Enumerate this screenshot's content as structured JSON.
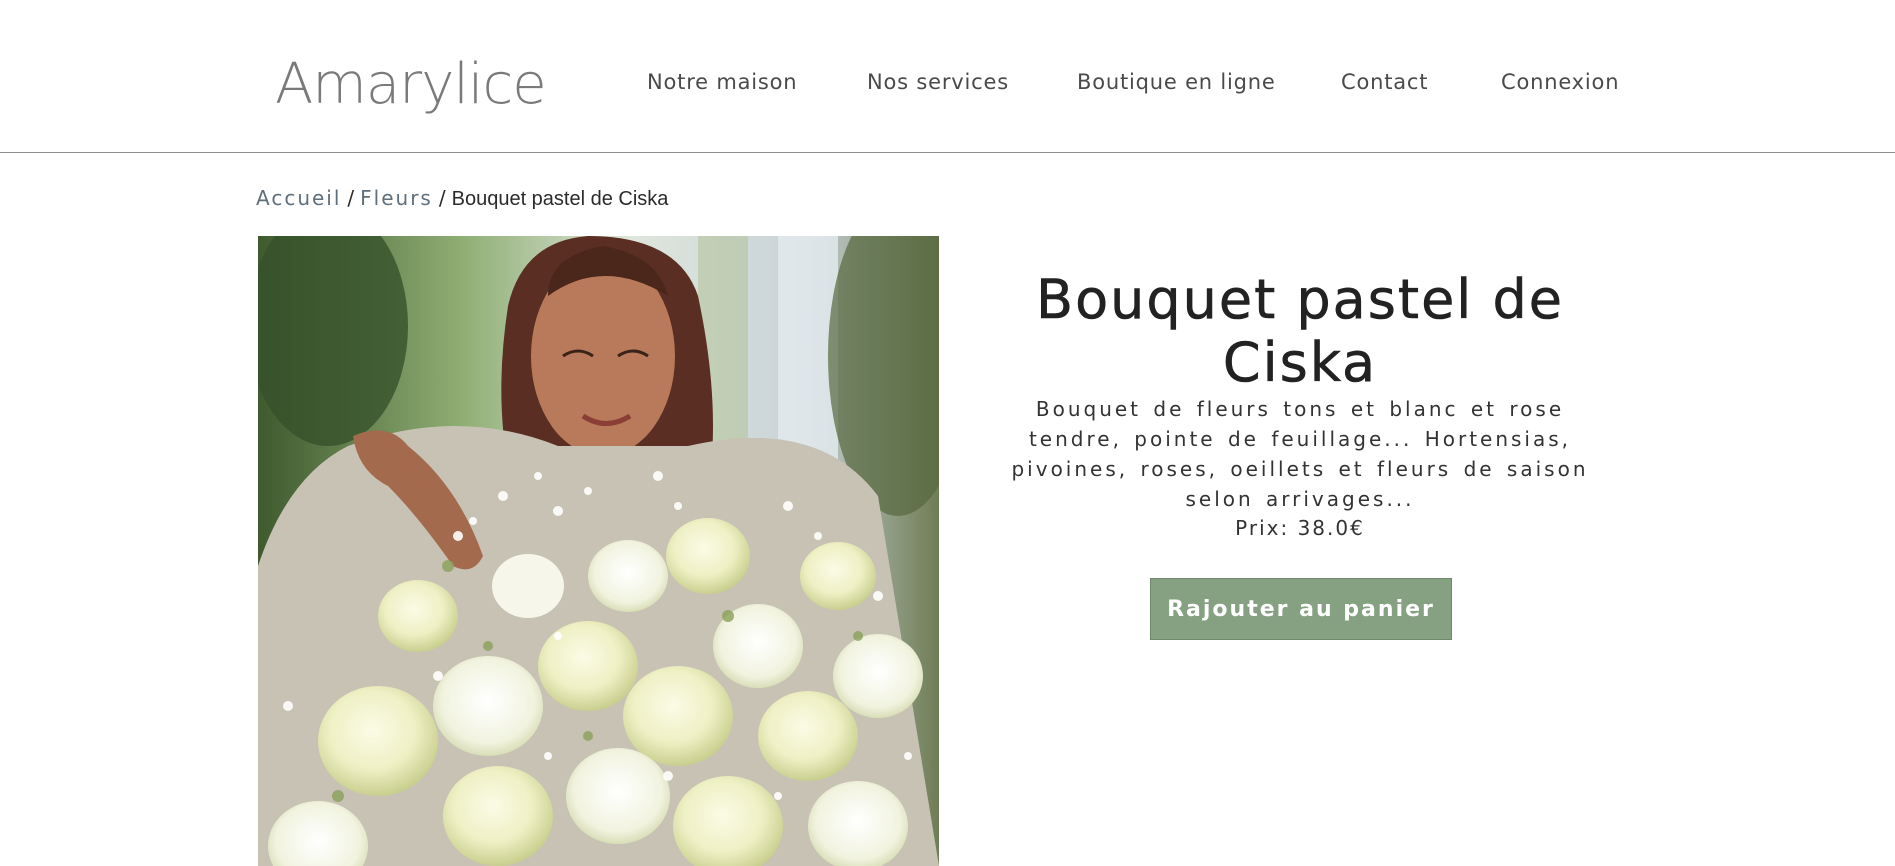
{
  "header": {
    "logo_text": "Amarylice",
    "nav": [
      {
        "label": "Notre maison"
      },
      {
        "label": "Nos services"
      },
      {
        "label": "Boutique en ligne"
      },
      {
        "label": "Contact"
      },
      {
        "label": "Connexion"
      }
    ]
  },
  "breadcrumb": {
    "home": "Accueil",
    "category": "Fleurs",
    "separator": "/",
    "current": "Bouquet pastel de Ciska"
  },
  "product": {
    "title": "Bouquet pastel de Ciska",
    "description": "Bouquet de fleurs tons et blanc et rose tendre, pointe de feuillage... Hortensias, pivoines, roses, oeillets et fleurs de saison selon arrivages...",
    "price_label": "Prix: 38.0€",
    "add_to_cart_label": "Rajouter au panier"
  },
  "colors": {
    "button": "#85a181",
    "link": "#5f6f7c",
    "logo": "#7a7a7a"
  }
}
